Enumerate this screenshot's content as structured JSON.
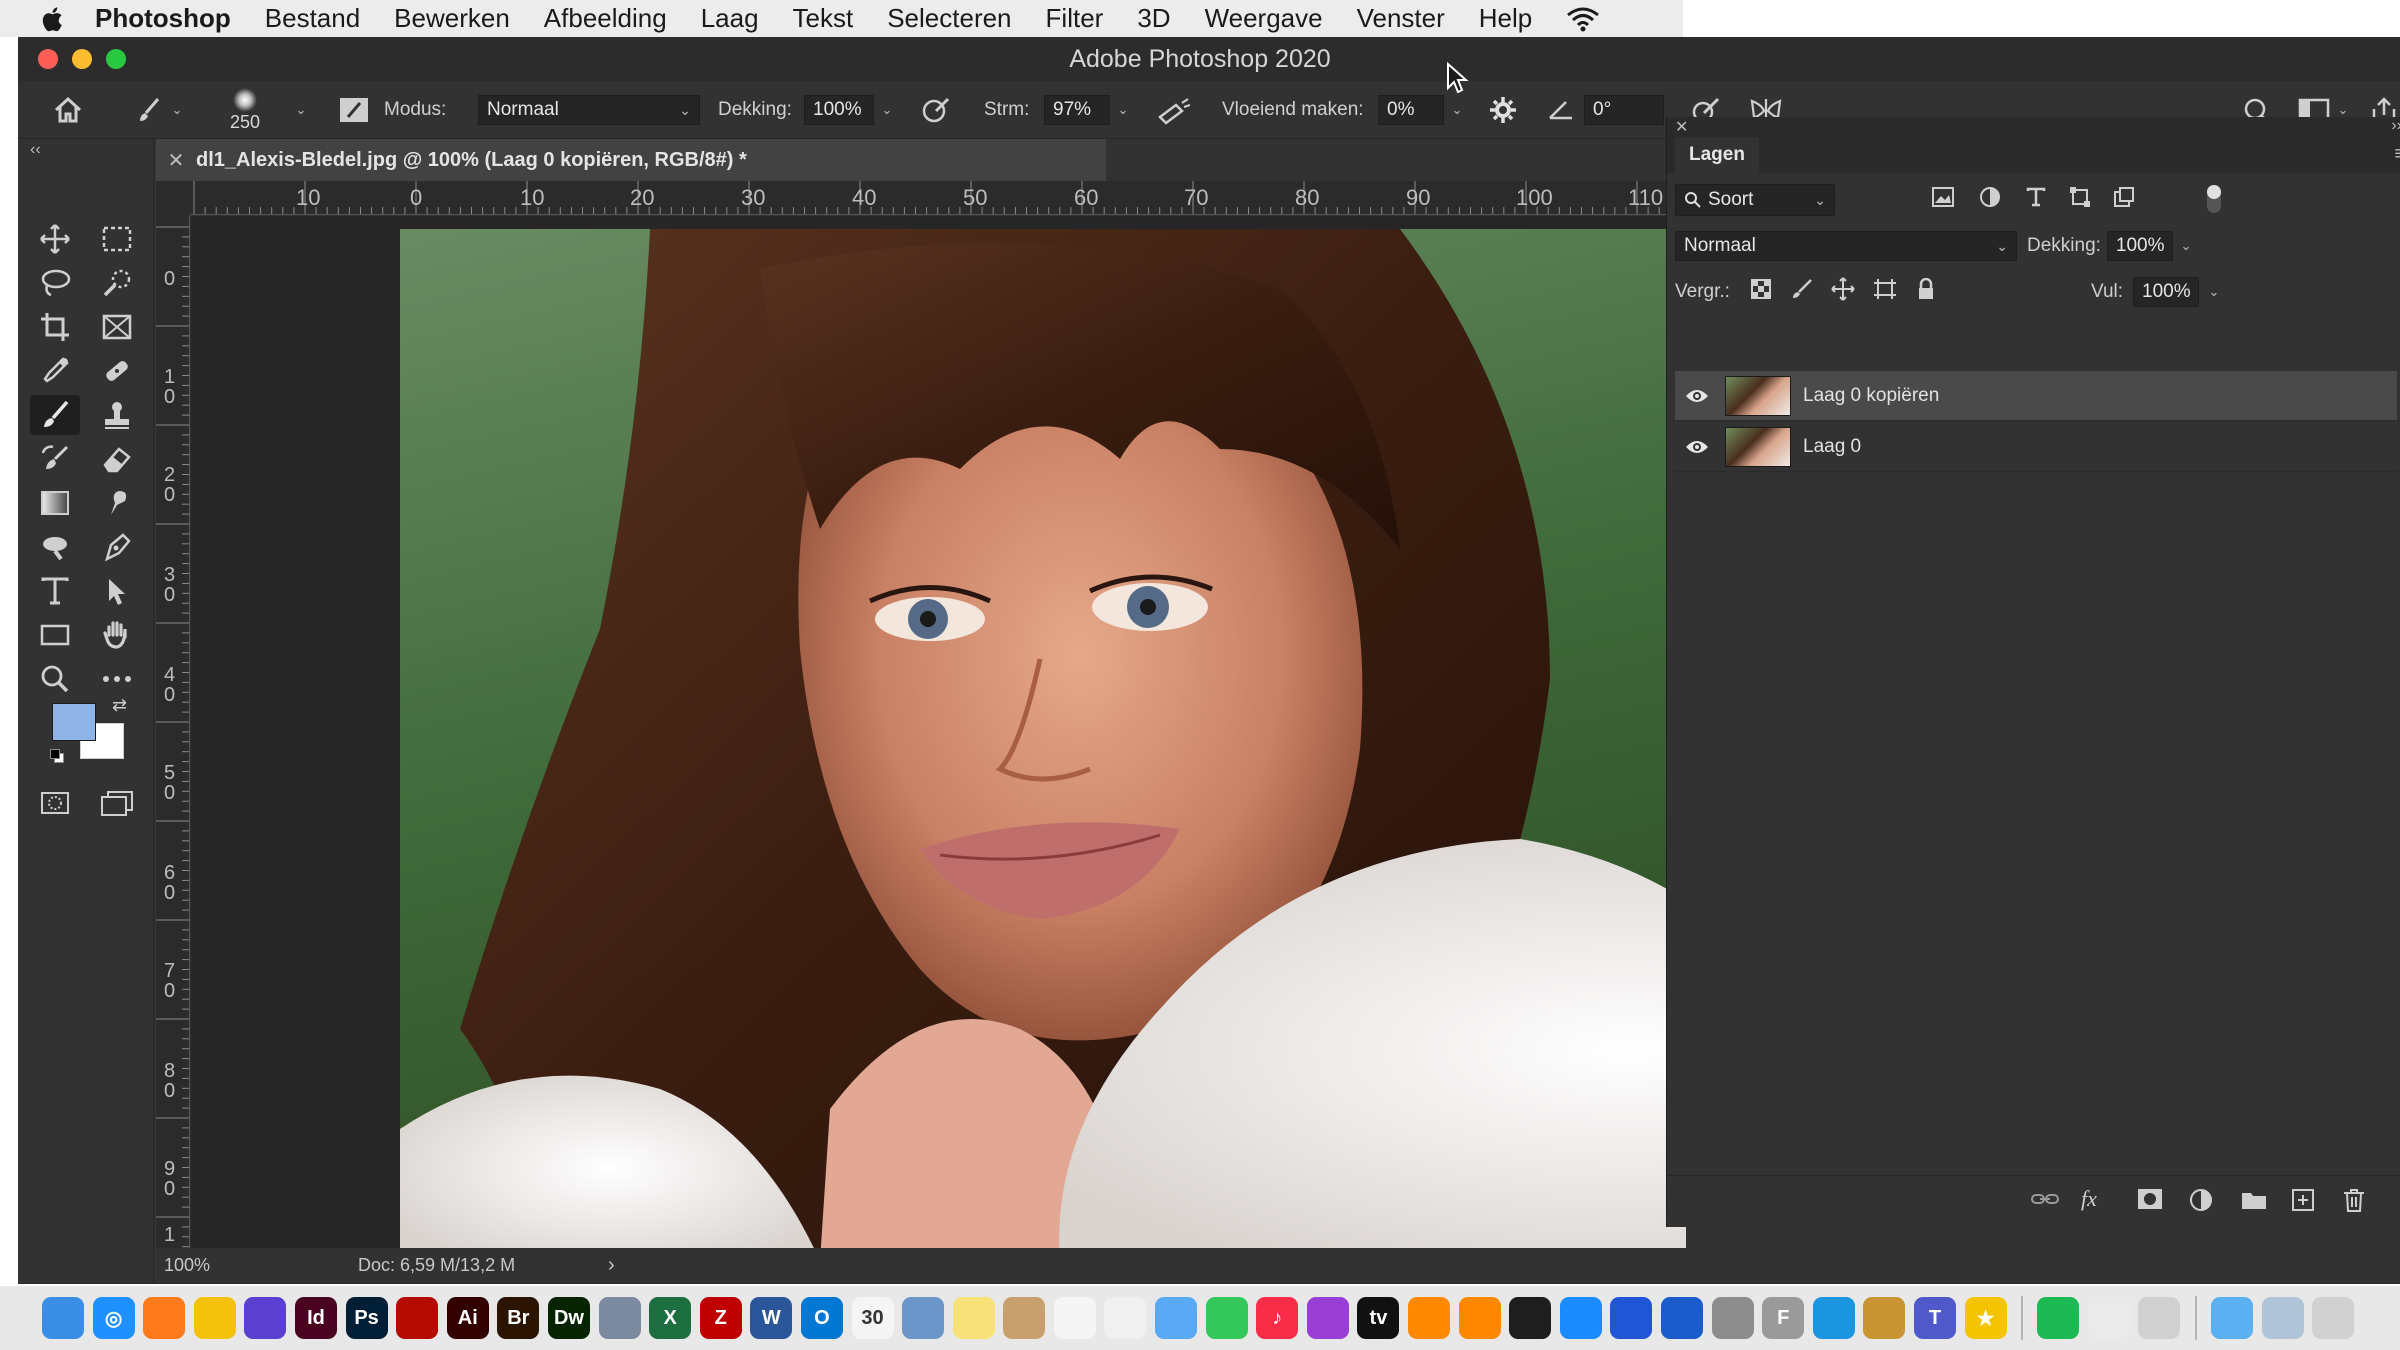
{
  "menubar": {
    "app_name": "Photoshop",
    "items": [
      "Bestand",
      "Bewerken",
      "Afbeelding",
      "Laag",
      "Tekst",
      "Selecteren",
      "Filter",
      "3D",
      "Weergave",
      "Venster",
      "Help"
    ]
  },
  "window": {
    "title": "Adobe Photoshop 2020",
    "traffic_colors": {
      "close": "#ff5f57",
      "minimize": "#febc2e",
      "zoom": "#28c840"
    }
  },
  "options": {
    "brush_size": "250",
    "mode_label": "Modus:",
    "mode_value": "Normaal",
    "opacity_label": "Dekking:",
    "opacity_value": "100%",
    "flow_label": "Strm:",
    "flow_value": "97%",
    "smoothing_label": "Vloeiend maken:",
    "smoothing_value": "0%",
    "angle_value": "0°"
  },
  "document": {
    "tab_title": "dl1_Alexis-Bledel.jpg @ 100% (Laag 0 kopiëren, RGB/8#) *",
    "ruler_top_labels": [
      "10",
      "0",
      "10",
      "20",
      "30",
      "40",
      "50",
      "60",
      "70",
      "80",
      "90",
      "100",
      "110"
    ],
    "ruler_left_labels": [
      "0",
      "1\n0",
      "2\n0",
      "3\n0",
      "4\n0",
      "5\n0",
      "6\n0",
      "7\n0",
      "8\n0",
      "9\n0",
      "1"
    ],
    "zoom": "100%",
    "doc_info": "Doc: 6,59 M/13,2 M"
  },
  "layers_panel": {
    "tab_label": "Lagen",
    "filter_label": "Soort",
    "blend_mode": "Normaal",
    "opacity_label": "Dekking:",
    "opacity_value": "100%",
    "lock_label": "Vergr.:",
    "fill_label": "Vul:",
    "fill_value": "100%",
    "layers": [
      {
        "name": "Laag 0 kopiëren",
        "selected": true
      },
      {
        "name": "Laag 0",
        "selected": false
      }
    ]
  },
  "colors": {
    "foreground": "#8fb3e6",
    "background": "#ffffff"
  },
  "dock": {
    "apps": [
      {
        "name": "finder",
        "color": "#3a8ee6",
        "glyph": ""
      },
      {
        "name": "safari",
        "color": "#1e90ff",
        "glyph": "◎"
      },
      {
        "name": "firefox",
        "color": "#ff7a1a",
        "glyph": ""
      },
      {
        "name": "chrome",
        "color": "#f4c20d",
        "glyph": ""
      },
      {
        "name": "siri",
        "color": "#5a3fd1",
        "glyph": ""
      },
      {
        "name": "indesign",
        "color": "#49021f",
        "glyph": "Id"
      },
      {
        "name": "photoshop",
        "color": "#001e36",
        "glyph": "Ps"
      },
      {
        "name": "acrobat",
        "color": "#b30b00",
        "glyph": ""
      },
      {
        "name": "illustrator",
        "color": "#330000",
        "glyph": "Ai"
      },
      {
        "name": "bridge",
        "color": "#2b1400",
        "glyph": "Br"
      },
      {
        "name": "dreamweaver",
        "color": "#072401",
        "glyph": "Dw"
      },
      {
        "name": "launchpad",
        "color": "#7c8aa0",
        "glyph": ""
      },
      {
        "name": "excel",
        "color": "#1d6f42",
        "glyph": "X"
      },
      {
        "name": "filezilla",
        "color": "#bf0000",
        "glyph": "Z"
      },
      {
        "name": "word",
        "color": "#2b579a",
        "glyph": "W"
      },
      {
        "name": "outlook",
        "color": "#0078d4",
        "glyph": "O"
      },
      {
        "name": "calendar",
        "color": "#f5f5f5",
        "glyph": "30"
      },
      {
        "name": "preview",
        "color": "#6c95c9",
        "glyph": ""
      },
      {
        "name": "notes",
        "color": "#f7e27a",
        "glyph": ""
      },
      {
        "name": "contacts",
        "color": "#c8a06e",
        "glyph": ""
      },
      {
        "name": "reminders",
        "color": "#f5f5f5",
        "glyph": ""
      },
      {
        "name": "photos",
        "color": "#f0f0f0",
        "glyph": ""
      },
      {
        "name": "messages-alt",
        "color": "#5aa9f5",
        "glyph": ""
      },
      {
        "name": "messages",
        "color": "#34c759",
        "glyph": ""
      },
      {
        "name": "music",
        "color": "#fa2d48",
        "glyph": "♪"
      },
      {
        "name": "podcasts",
        "color": "#9a3fd6",
        "glyph": ""
      },
      {
        "name": "tv",
        "color": "#111111",
        "glyph": "tv"
      },
      {
        "name": "books",
        "color": "#ff8a00",
        "glyph": ""
      },
      {
        "name": "vlc",
        "color": "#ff8800",
        "glyph": ""
      },
      {
        "name": "terminal",
        "color": "#1e1e1e",
        "glyph": ""
      },
      {
        "name": "app-store",
        "color": "#1a8cff",
        "glyph": ""
      },
      {
        "name": "mailplane",
        "color": "#2056d6",
        "glyph": ""
      },
      {
        "name": "quicktime",
        "color": "#1a5ccc",
        "glyph": ""
      },
      {
        "name": "system-preferences",
        "color": "#8d8d8d",
        "glyph": ""
      },
      {
        "name": "font-book",
        "color": "#9a9a9a",
        "glyph": "F"
      },
      {
        "name": "tweetdeck",
        "color": "#1b95e0",
        "glyph": ""
      },
      {
        "name": "notebook",
        "color": "#c99532",
        "glyph": ""
      },
      {
        "name": "teams",
        "color": "#5059c9",
        "glyph": "T"
      },
      {
        "name": "reeder",
        "color": "#f5c400",
        "glyph": "★"
      },
      {
        "name": "spotify",
        "color": "#1db954",
        "glyph": ""
      },
      {
        "name": "textedit",
        "color": "#eaeaea",
        "glyph": ""
      },
      {
        "name": "screenshot",
        "color": "#d0d0d0",
        "glyph": ""
      },
      {
        "name": "folder",
        "color": "#5ab0f0",
        "glyph": ""
      },
      {
        "name": "downloads",
        "color": "#b0c4d8",
        "glyph": ""
      },
      {
        "name": "trash",
        "color": "#d0d0d0",
        "glyph": ""
      }
    ]
  }
}
